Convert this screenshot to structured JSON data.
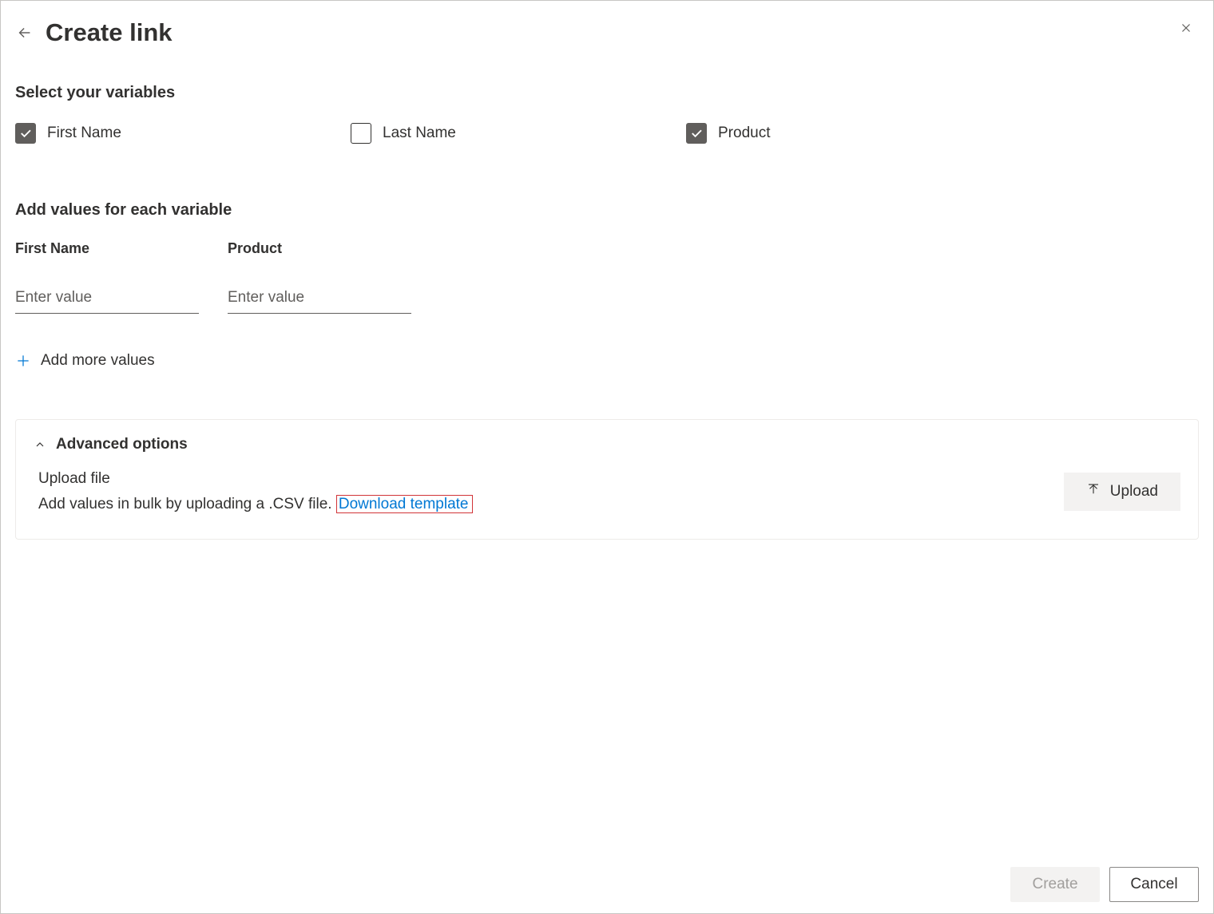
{
  "header": {
    "title": "Create link"
  },
  "variables": {
    "heading": "Select your variables",
    "items": [
      {
        "label": "First Name",
        "checked": true
      },
      {
        "label": "Last Name",
        "checked": false
      },
      {
        "label": "Product",
        "checked": true
      }
    ]
  },
  "values": {
    "heading": "Add values for each variable",
    "fields": [
      {
        "label": "First Name",
        "placeholder": "Enter value",
        "value": ""
      },
      {
        "label": "Product",
        "placeholder": "Enter value",
        "value": ""
      }
    ],
    "add_more_label": "Add more values"
  },
  "advanced": {
    "title": "Advanced options",
    "upload_file_label": "Upload file",
    "upload_description": "Add values in bulk by uploading a .CSV file. ",
    "download_link_label": "Download template",
    "upload_button_label": "Upload"
  },
  "footer": {
    "create_label": "Create",
    "cancel_label": "Cancel"
  }
}
